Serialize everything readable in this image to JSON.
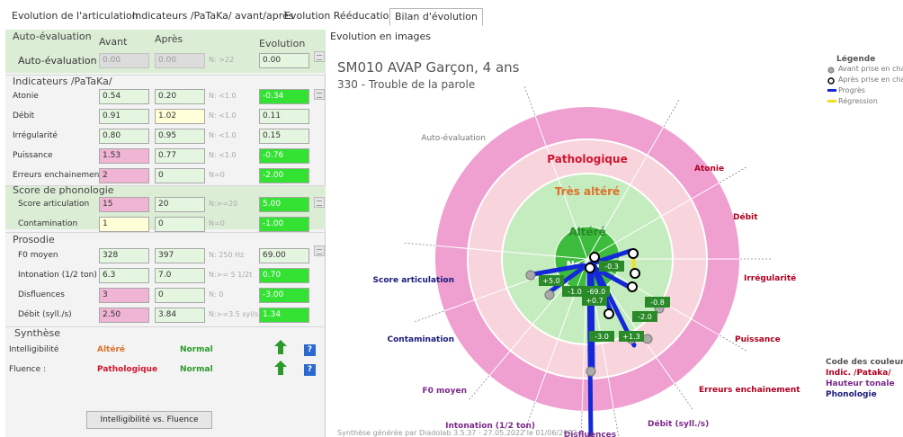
{
  "tabs": [
    {
      "label": "Evolution de l'articulation",
      "active": false
    },
    {
      "label": "Indicateurs /PaTaKa/ avant/après",
      "active": false
    },
    {
      "label": "Evolution Rééducation",
      "active": false
    },
    {
      "label": "Bilan d'évolution",
      "active": true
    }
  ],
  "auto": {
    "title": "Auto-évaluation",
    "col_avant": "Avant",
    "col_apres": "Après",
    "col_evolution": "Evolution",
    "row": {
      "label": "Auto-évaluation",
      "avant": "0.00",
      "apres": "0.00",
      "norm": "N: >22",
      "evolution": "0.00"
    }
  },
  "indicateurs": {
    "title": "Indicateurs /PaTaKa/",
    "rows": [
      {
        "label": "Atonie",
        "avant": "0.54",
        "apres": "0.20",
        "norm": "N: <1.0",
        "evolution": "-0.34"
      },
      {
        "label": "Débit",
        "avant": "0.91",
        "apres": "1.02",
        "norm": "N: <1.0",
        "evolution": "0.11"
      },
      {
        "label": "Irrégularité",
        "avant": "0.80",
        "apres": "0.95",
        "norm": "N: <1.0",
        "evolution": "0.15"
      },
      {
        "label": "Puissance",
        "avant": "1.53",
        "apres": "0.77",
        "norm": "N: <1.0",
        "evolution": "-0.76"
      },
      {
        "label": "Erreurs enchainement",
        "avant": "2",
        "apres": "0",
        "norm": "N=0",
        "evolution": "-2.00"
      }
    ]
  },
  "phonologie": {
    "title": "Score de phonologie",
    "rows": [
      {
        "label": "Score articulation",
        "avant": "15",
        "apres": "20",
        "norm": "N:>=20",
        "evolution": "5.00"
      },
      {
        "label": "Contamination",
        "avant": "1",
        "apres": "0",
        "norm": "N=0",
        "evolution": "-1.00"
      }
    ]
  },
  "prosodie": {
    "title": "Prosodie",
    "rows": [
      {
        "label": "F0 moyen",
        "avant": "328",
        "apres": "397",
        "norm": "N: 250 Hz",
        "evolution": "69.00"
      },
      {
        "label": "Intonation (1/2 ton)",
        "avant": "6.3",
        "apres": "7.0",
        "norm": "N:>= 5 1/2t",
        "evolution": "0.70"
      },
      {
        "label": "Disfluences",
        "avant": "3",
        "apres": "0",
        "norm": "N: 0",
        "evolution": "-3.00"
      },
      {
        "label": "Débit (syll./s)",
        "avant": "2.50",
        "apres": "3.84",
        "norm": "N:>=3.5 syl/s",
        "evolution": "1.34"
      }
    ]
  },
  "synthese": {
    "title": "Synthèse",
    "rows": [
      {
        "label": "Intelligibilité",
        "avant": "Altéré",
        "apres": "Normal"
      },
      {
        "label": "Fluence :",
        "avant": "Pathologique",
        "apres": "Normal"
      }
    ],
    "button": "Intelligibilité vs. Fluence",
    "help": "?"
  },
  "colors": {
    "altere": "#e0702a",
    "pathologique": "#d0152e",
    "normal": "#2a9a2a",
    "progres": "#1428d8",
    "regression": "#f0e020",
    "ring_patho": "#ef9fd0",
    "ring_tres": "#f8d4dc",
    "ring_altere": "#c4ecbe",
    "ring_normal": "#3dbb3d"
  },
  "evolution": {
    "title": "Evolution en images",
    "patient": "SM010 AVAP Garçon, 4 ans",
    "diagnostic": "330 - Trouble de la parole",
    "zones": {
      "patho": "Pathologique",
      "tres": "Très altéré",
      "altere": "Altéré",
      "normal": "Normal"
    },
    "legend": {
      "title": "Légende",
      "avant": "Avant prise en charge",
      "apres": "Après prise en charge",
      "progres": "Progrès",
      "regression": "Régression"
    },
    "codes": {
      "title": "Code des couleurs",
      "pataka": "Indic. /Pataka/",
      "hauteur": "Hauteur tonale",
      "phono": "Phonologie"
    },
    "footer": "Synthèse générée par Diadolab 3.5.37 - 27.05.2022 le 01/06/2022"
  },
  "chart_data": {
    "type": "radial",
    "axes": [
      {
        "name": "Auto-évaluation",
        "avant": 0.0,
        "apres": 0.0,
        "label": ""
      },
      {
        "name": "Atonie",
        "avant": 0.54,
        "apres": 0.2,
        "label": "-0.3"
      },
      {
        "name": "Débit",
        "avant": 0.91,
        "apres": 1.02,
        "label": ""
      },
      {
        "name": "Irrégularité",
        "avant": 0.8,
        "apres": 0.95,
        "label": ""
      },
      {
        "name": "Puissance",
        "avant": 1.53,
        "apres": 0.77,
        "label": "-0.8"
      },
      {
        "name": "Erreurs enchainement",
        "avant": 2,
        "apres": 0,
        "label": "-2.0"
      },
      {
        "name": "Débit (syll./s)",
        "avant": 2.5,
        "apres": 3.84,
        "label": "+1.3"
      },
      {
        "name": "Disfluences",
        "avant": 3,
        "apres": 0,
        "label": "-3.0"
      },
      {
        "name": "Intonation (1/2 ton)",
        "avant": 6.3,
        "apres": 7.0,
        "label": "+0.7"
      },
      {
        "name": "F0 moyen",
        "avant": 328,
        "apres": 397,
        "label": "+69.0"
      },
      {
        "name": "Contamination",
        "avant": 1,
        "apres": 0,
        "label": "-1.0"
      },
      {
        "name": "Score articulation",
        "avant": 15,
        "apres": 20,
        "label": "+5.0"
      }
    ]
  }
}
